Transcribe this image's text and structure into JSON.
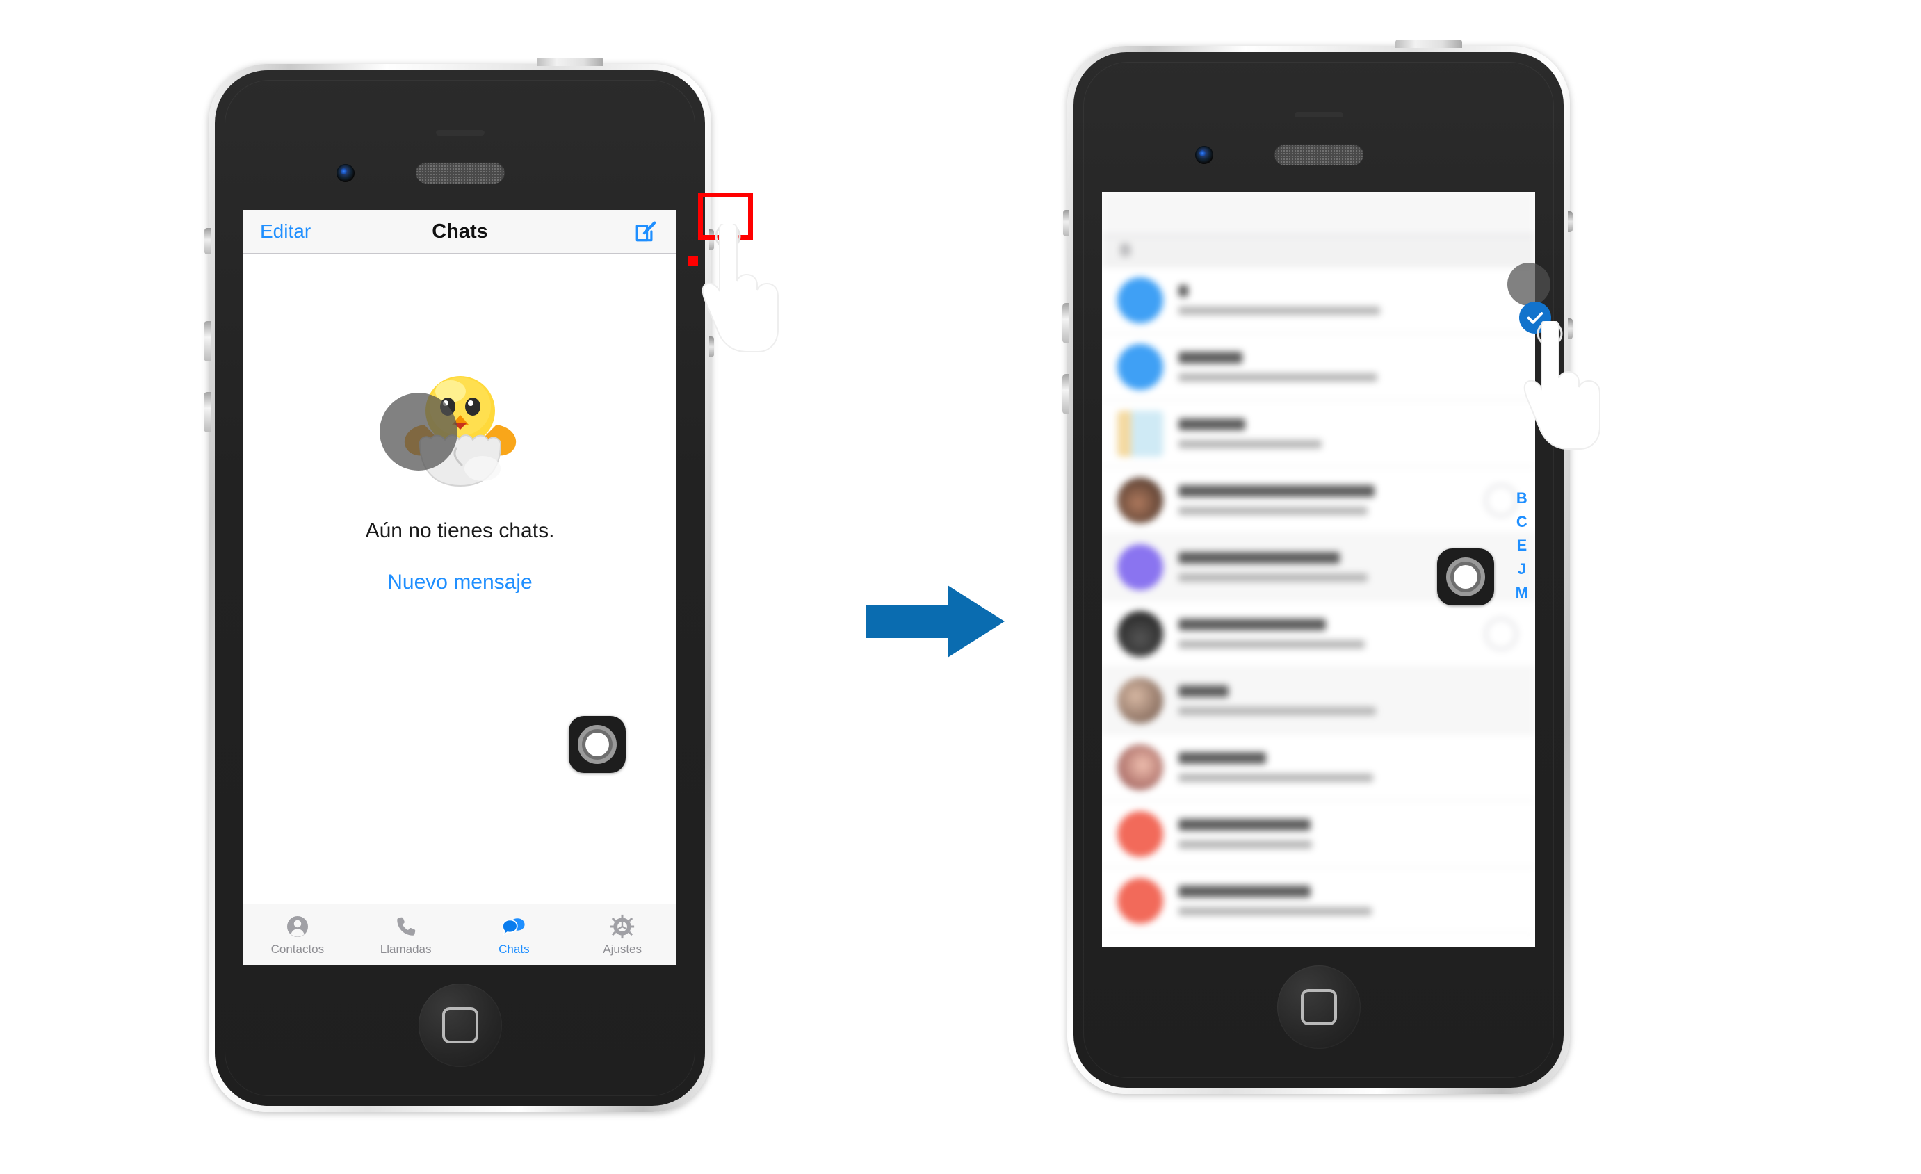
{
  "tutorial": {
    "arrow_color": "#0a6cb0",
    "highlight_color": "#ff0000"
  },
  "left_phone": {
    "name": "iphone-chats-empty",
    "navbar": {
      "left_button": "Editar",
      "title": "Chats",
      "right_icon": "compose-icon"
    },
    "empty_state": {
      "illustration": "hatching-chick-emoji",
      "message": "Aún no tienes chats.",
      "action_link": "Nuevo mensaje"
    },
    "tabbar": [
      {
        "label": "Contactos",
        "icon": "person-icon",
        "active": false
      },
      {
        "label": "Llamadas",
        "icon": "phone-icon",
        "active": false
      },
      {
        "label": "Chats",
        "icon": "chat-bubbles-icon",
        "active": true
      },
      {
        "label": "Ajustes",
        "icon": "gear-icon",
        "active": false
      }
    ],
    "overlays": {
      "highlight_target": "compose-button",
      "cursor": "pointing-hand-cursor",
      "assistive_touch": "assistive-touch-button"
    }
  },
  "right_phone": {
    "name": "iphone-contact-picker",
    "navbar": {
      "title": ""
    },
    "section_header": "B",
    "contacts": [
      {
        "name": "",
        "subtitle": "",
        "avatar_color": "#3fa0f5",
        "selected": true
      },
      {
        "name": "",
        "subtitle": "",
        "avatar_color": "#3fa0f5",
        "selected": false
      },
      {
        "name": "",
        "subtitle": "",
        "avatar_color": "#d8eef7",
        "selected": false
      },
      {
        "name": "",
        "subtitle": "",
        "avatar_color": "#4a3a33",
        "selected": false
      },
      {
        "name": "",
        "subtitle": "",
        "avatar_color": "#8a74f0",
        "selected": false
      },
      {
        "name": "",
        "subtitle": "",
        "avatar_color": "#2e2e2e",
        "selected": false
      },
      {
        "name": "",
        "subtitle": "",
        "avatar_color": "#a08272",
        "selected": false
      },
      {
        "name": "",
        "subtitle": "",
        "avatar_color": "#9c6b63",
        "selected": false
      },
      {
        "name": "",
        "subtitle": "",
        "avatar_color": "#f26a5a",
        "selected": false
      },
      {
        "name": "",
        "subtitle": "",
        "avatar_color": "#f26a5a",
        "selected": false
      }
    ],
    "index_letters": [
      "B",
      "C",
      "E",
      "J",
      "M"
    ],
    "overlays": {
      "selection_check": "checkmark-icon",
      "cursor": "pointing-hand-cursor",
      "assistive_touch": "assistive-touch-button"
    }
  }
}
